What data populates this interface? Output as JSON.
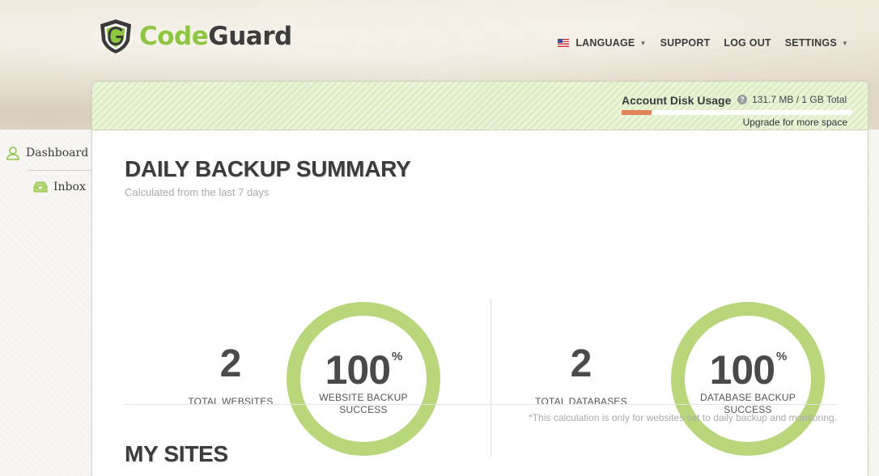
{
  "brand": {
    "name_part1": "Code",
    "name_part2": "Guard",
    "logo_icon": "shield-g-icon",
    "accent": "#8dc63f"
  },
  "nav": {
    "language": {
      "label": "LANGUAGE",
      "icon": "us-flag-icon"
    },
    "support": "SUPPORT",
    "logout": "LOG OUT",
    "settings": "SETTINGS"
  },
  "disk_usage": {
    "label": "Account Disk Usage",
    "value": "131.7 MB / 1 GB Total",
    "fraction": 0.129,
    "upgrade": "Upgrade for more space",
    "bar_color": "#e2835c"
  },
  "sidebar": {
    "items": [
      {
        "label": "Dashboard",
        "icon": "user-icon"
      },
      {
        "label": "Inbox",
        "icon": "inbox-tray-icon"
      }
    ]
  },
  "summary": {
    "title": "DAILY BACKUP SUMMARY",
    "subtitle": "Calculated from the last 7 days",
    "websites": {
      "count": "2",
      "count_label": "TOTAL WEBSITES",
      "percent": "100",
      "percent_sign": "%",
      "ring_label_1": "WEBSITE BACKUP",
      "ring_label_2": "SUCCESS"
    },
    "databases": {
      "count": "2",
      "count_label": "TOTAL DATABASES",
      "percent": "100",
      "percent_sign": "%",
      "ring_label_1": "DATABASE BACKUP",
      "ring_label_2": "SUCCESS"
    },
    "ring_color": "#b9d77a",
    "footnote": "*This calculation is only for websites set to daily backup and monitoring."
  },
  "my_sites": {
    "title": "MY SITES"
  }
}
